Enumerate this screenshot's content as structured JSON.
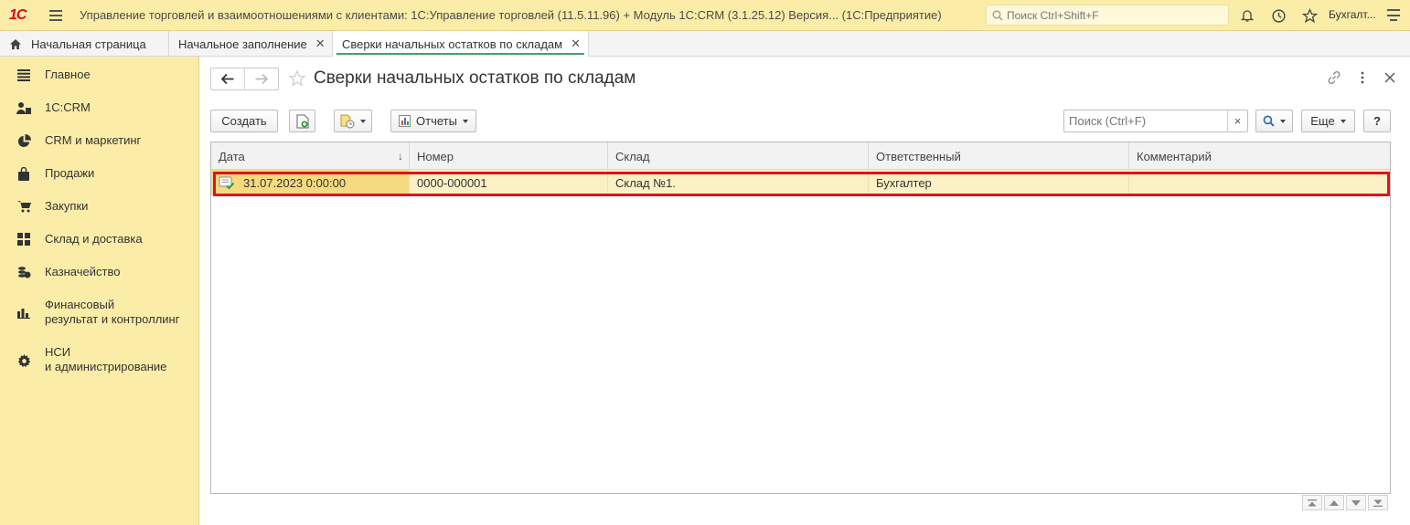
{
  "app": {
    "logo_text": "1С",
    "title": "Управление торговлей и взаимоотношениями с клиентами: 1С:Управление торговлей (11.5.11.96) + Модуль 1С:CRM (3.1.25.12) Версия...  (1С:Предприятие)",
    "search_placeholder": "Поиск Ctrl+Shift+F",
    "user": "Бухгалт..."
  },
  "tabs": [
    {
      "label": "Начальная страница",
      "icon": "home-icon",
      "active": false
    },
    {
      "label": "Начальное заполнение",
      "closable": true,
      "active": false
    },
    {
      "label": "Сверки начальных остатков по складам",
      "closable": true,
      "active": true
    }
  ],
  "sidebar": {
    "items": [
      {
        "label": "Главное",
        "icon": "list-icon"
      },
      {
        "label": "1С:CRM",
        "icon": "crm-users-icon"
      },
      {
        "label": "CRM и маркетинг",
        "icon": "pie-chart-icon"
      },
      {
        "label": "Продажи",
        "icon": "bag-icon"
      },
      {
        "label": "Закупки",
        "icon": "cart-icon"
      },
      {
        "label": "Склад и доставка",
        "icon": "warehouse-grid-icon"
      },
      {
        "label": "Казначейство",
        "icon": "coins-icon"
      },
      {
        "label_line1": "Финансовый",
        "label_line2": "результат и контроллинг",
        "icon": "bar-chart-icon"
      },
      {
        "label_line1": "НСИ",
        "label_line2": "и администрирование",
        "icon": "gear-icon"
      }
    ]
  },
  "form": {
    "title": "Сверки начальных остатков по складам",
    "toolbar": {
      "create_label": "Создать",
      "reports_label": "Отчеты",
      "search_placeholder": "Поиск (Ctrl+F)",
      "clear_label": "×",
      "more_label": "Еще",
      "help_label": "?"
    },
    "columns": [
      "Дата",
      "Номер",
      "Склад",
      "Ответственный",
      "Комментарий"
    ],
    "sort_indicator": "↓",
    "rows": [
      {
        "date": "31.07.2023 0:00:00",
        "number": "0000-000001",
        "warehouse": "Склад №1.",
        "responsible": "Бухгалтер",
        "comment": ""
      }
    ]
  },
  "colors": {
    "section_bg": "#fbeda8",
    "row_highlight": "#fbf1c4",
    "selected_cell": "#f6da7f",
    "callout_border": "#e0121f",
    "active_tab_underline": "#3da46b"
  }
}
